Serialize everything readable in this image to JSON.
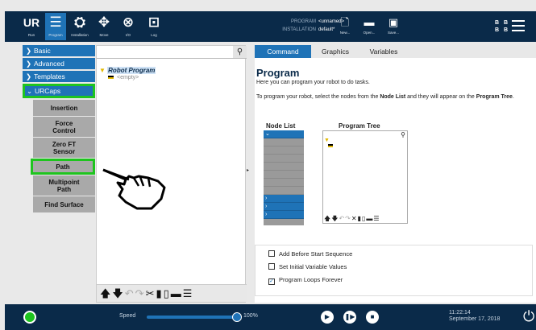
{
  "header": {
    "nav_buttons": [
      {
        "icon": "UR",
        "label": "Run"
      },
      {
        "icon": "≡",
        "label": "Program"
      },
      {
        "icon": "⚙",
        "label": "Installation"
      },
      {
        "icon": "✥",
        "label": "Move"
      },
      {
        "icon": "⊕",
        "label": "I/O"
      },
      {
        "icon": "⌇",
        "label": "Log"
      }
    ],
    "program_key": "PROGRAM",
    "program_value": "<unnamed>",
    "installation_key": "INSTALLATION",
    "installation_value": "default*",
    "file_buttons": [
      {
        "icon": "new-file-icon",
        "label": "New..."
      },
      {
        "icon": "folder-icon",
        "label": "Open..."
      },
      {
        "icon": "save-icon",
        "label": "Save..."
      }
    ],
    "status_letters": [
      "B B",
      "B B"
    ]
  },
  "left_nav": {
    "items": [
      {
        "label": "Basic",
        "chevron": "›"
      },
      {
        "label": "Advanced",
        "chevron": "›"
      },
      {
        "label": "Templates",
        "chevron": "›"
      },
      {
        "label": "URCaps",
        "chevron": "⌄"
      }
    ],
    "urcaps_sub": [
      "Insertion",
      "Force Control",
      "Zero FT Sensor",
      "Path",
      "Multipoint Path",
      "Find Surface"
    ]
  },
  "tree": {
    "root": "Robot Program",
    "empty": "<empty>"
  },
  "right": {
    "tabs": [
      "Command",
      "Graphics",
      "Variables"
    ],
    "title": "Program",
    "intro": "Here you can program your robot to do tasks.",
    "instr_1": "To program your robot, select the nodes from the",
    "instr_bold1": "Node List",
    "instr_2": "and they will appear on the",
    "instr_bold2": "Program Tree",
    "node_list_label": "Node List",
    "program_tree_label": "Program Tree",
    "options": [
      {
        "label": "Add Before Start Sequence",
        "checked": false
      },
      {
        "label": "Set Initial Variable Values",
        "checked": false
      },
      {
        "label": "Program Loops Forever",
        "checked": true
      }
    ]
  },
  "footer": {
    "speed_label": "Speed",
    "speed_value": "100%",
    "speed_fraction": 1.0,
    "time": "11:22:14",
    "date": "September 17, 2018"
  }
}
